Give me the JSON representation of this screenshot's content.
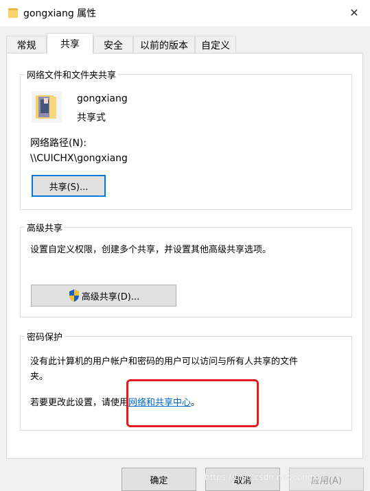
{
  "window": {
    "title": "gongxiang 属性",
    "close_glyph": "✕"
  },
  "tabs": [
    {
      "label": "常规"
    },
    {
      "label": "共享"
    },
    {
      "label": "安全"
    },
    {
      "label": "以前的版本"
    },
    {
      "label": "自定义"
    }
  ],
  "network_sharing": {
    "group_label": "网络文件和文件夹共享",
    "folder_name": "gongxiang",
    "share_status": "共享式",
    "path_label": "网络路径(N):",
    "path_value": "\\\\CUICHX\\gongxiang",
    "share_button": "共享(S)..."
  },
  "advanced_sharing": {
    "group_label": "高级共享",
    "description": "设置自定义权限，创建多个共享，并设置其他高级共享选项。",
    "button": "高级共享(D)..."
  },
  "password_protection": {
    "group_label": "密码保护",
    "description_line1": "没有此计算机的用户帐户和密码的用户可以访问与所有人共享的文件",
    "description_line2": "夹。",
    "change_prefix": "若要更改此设置，请使用",
    "link_text": "网络和共享中心",
    "change_suffix": "。"
  },
  "footer": {
    "ok": "确定",
    "cancel": "取消",
    "apply": "应用(A)"
  },
  "watermark": "https://blog.csdn.net/congxin",
  "colors": {
    "accent": "#0078d7",
    "link": "#0066cc",
    "highlight_box": "#e51b1b",
    "shield_blue": "#1f5fbf",
    "shield_yellow": "#f2c12e"
  },
  "icons": {
    "folder": "folder-icon",
    "folder_thumbnail": "folder-thumbnail-icon",
    "shield": "uac-shield-icon",
    "close": "close-icon"
  }
}
